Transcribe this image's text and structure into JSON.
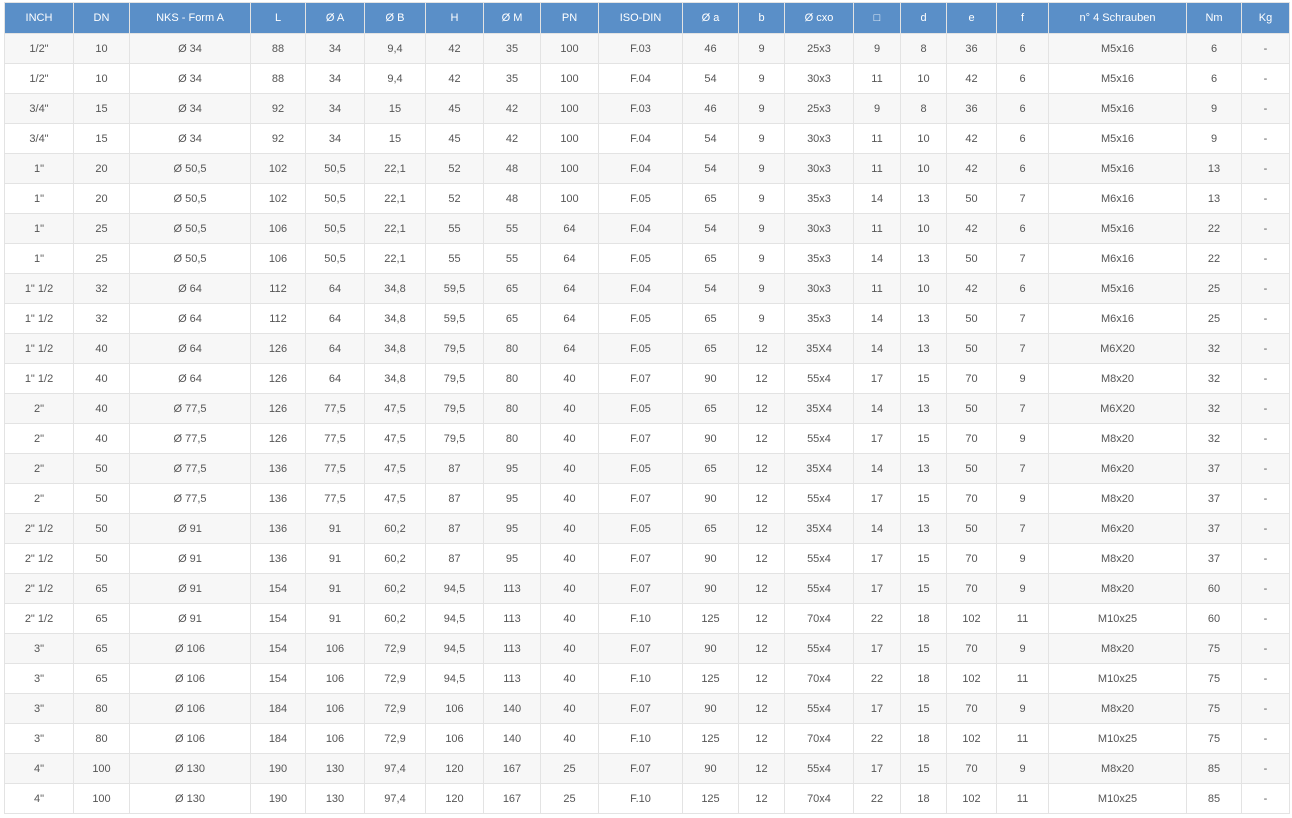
{
  "table": {
    "headers": [
      "INCH",
      "DN",
      "NKS - Form A",
      "L",
      "Ø A",
      "Ø B",
      "H",
      "Ø M",
      "PN",
      "ISO-DIN",
      "Ø a",
      "b",
      "Ø cxo",
      "□",
      "d",
      "e",
      "f",
      "n° 4 Schrauben",
      "Nm",
      "Kg"
    ],
    "rows": [
      [
        "1/2\"",
        "10",
        "Ø 34",
        "88",
        "34",
        "9,4",
        "42",
        "35",
        "100",
        "F.03",
        "46",
        "9",
        "25x3",
        "9",
        "8",
        "36",
        "6",
        "M5x16",
        "6",
        "-"
      ],
      [
        "1/2\"",
        "10",
        "Ø 34",
        "88",
        "34",
        "9,4",
        "42",
        "35",
        "100",
        "F.04",
        "54",
        "9",
        "30x3",
        "11",
        "10",
        "42",
        "6",
        "M5x16",
        "6",
        "-"
      ],
      [
        "3/4\"",
        "15",
        "Ø 34",
        "92",
        "34",
        "15",
        "45",
        "42",
        "100",
        "F.03",
        "46",
        "9",
        "25x3",
        "9",
        "8",
        "36",
        "6",
        "M5x16",
        "9",
        "-"
      ],
      [
        "3/4\"",
        "15",
        "Ø 34",
        "92",
        "34",
        "15",
        "45",
        "42",
        "100",
        "F.04",
        "54",
        "9",
        "30x3",
        "11",
        "10",
        "42",
        "6",
        "M5x16",
        "9",
        "-"
      ],
      [
        "1\"",
        "20",
        "Ø 50,5",
        "102",
        "50,5",
        "22,1",
        "52",
        "48",
        "100",
        "F.04",
        "54",
        "9",
        "30x3",
        "11",
        "10",
        "42",
        "6",
        "M5x16",
        "13",
        "-"
      ],
      [
        "1\"",
        "20",
        "Ø 50,5",
        "102",
        "50,5",
        "22,1",
        "52",
        "48",
        "100",
        "F.05",
        "65",
        "9",
        "35x3",
        "14",
        "13",
        "50",
        "7",
        "M6x16",
        "13",
        "-"
      ],
      [
        "1\"",
        "25",
        "Ø 50,5",
        "106",
        "50,5",
        "22,1",
        "55",
        "55",
        "64",
        "F.04",
        "54",
        "9",
        "30x3",
        "11",
        "10",
        "42",
        "6",
        "M5x16",
        "22",
        "-"
      ],
      [
        "1\"",
        "25",
        "Ø 50,5",
        "106",
        "50,5",
        "22,1",
        "55",
        "55",
        "64",
        "F.05",
        "65",
        "9",
        "35x3",
        "14",
        "13",
        "50",
        "7",
        "M6x16",
        "22",
        "-"
      ],
      [
        "1\" 1/2",
        "32",
        "Ø 64",
        "112",
        "64",
        "34,8",
        "59,5",
        "65",
        "64",
        "F.04",
        "54",
        "9",
        "30x3",
        "11",
        "10",
        "42",
        "6",
        "M5x16",
        "25",
        "-"
      ],
      [
        "1\" 1/2",
        "32",
        "Ø 64",
        "112",
        "64",
        "34,8",
        "59,5",
        "65",
        "64",
        "F.05",
        "65",
        "9",
        "35x3",
        "14",
        "13",
        "50",
        "7",
        "M6x16",
        "25",
        "-"
      ],
      [
        "1\" 1/2",
        "40",
        "Ø 64",
        "126",
        "64",
        "34,8",
        "79,5",
        "80",
        "64",
        "F.05",
        "65",
        "12",
        "35X4",
        "14",
        "13",
        "50",
        "7",
        "M6X20",
        "32",
        "-"
      ],
      [
        "1\" 1/2",
        "40",
        "Ø 64",
        "126",
        "64",
        "34,8",
        "79,5",
        "80",
        "40",
        "F.07",
        "90",
        "12",
        "55x4",
        "17",
        "15",
        "70",
        "9",
        "M8x20",
        "32",
        "-"
      ],
      [
        "2\"",
        "40",
        "Ø 77,5",
        "126",
        "77,5",
        "47,5",
        "79,5",
        "80",
        "40",
        "F.05",
        "65",
        "12",
        "35X4",
        "14",
        "13",
        "50",
        "7",
        "M6X20",
        "32",
        "-"
      ],
      [
        "2\"",
        "40",
        "Ø 77,5",
        "126",
        "77,5",
        "47,5",
        "79,5",
        "80",
        "40",
        "F.07",
        "90",
        "12",
        "55x4",
        "17",
        "15",
        "70",
        "9",
        "M8x20",
        "32",
        "-"
      ],
      [
        "2\"",
        "50",
        "Ø 77,5",
        "136",
        "77,5",
        "47,5",
        "87",
        "95",
        "40",
        "F.05",
        "65",
        "12",
        "35X4",
        "14",
        "13",
        "50",
        "7",
        "M6x20",
        "37",
        "-"
      ],
      [
        "2\"",
        "50",
        "Ø 77,5",
        "136",
        "77,5",
        "47,5",
        "87",
        "95",
        "40",
        "F.07",
        "90",
        "12",
        "55x4",
        "17",
        "15",
        "70",
        "9",
        "M8x20",
        "37",
        "-"
      ],
      [
        "2\" 1/2",
        "50",
        "Ø 91",
        "136",
        "91",
        "60,2",
        "87",
        "95",
        "40",
        "F.05",
        "65",
        "12",
        "35X4",
        "14",
        "13",
        "50",
        "7",
        "M6x20",
        "37",
        "-"
      ],
      [
        "2\" 1/2",
        "50",
        "Ø 91",
        "136",
        "91",
        "60,2",
        "87",
        "95",
        "40",
        "F.07",
        "90",
        "12",
        "55x4",
        "17",
        "15",
        "70",
        "9",
        "M8x20",
        "37",
        "-"
      ],
      [
        "2\" 1/2",
        "65",
        "Ø 91",
        "154",
        "91",
        "60,2",
        "94,5",
        "113",
        "40",
        "F.07",
        "90",
        "12",
        "55x4",
        "17",
        "15",
        "70",
        "9",
        "M8x20",
        "60",
        "-"
      ],
      [
        "2\" 1/2",
        "65",
        "Ø 91",
        "154",
        "91",
        "60,2",
        "94,5",
        "113",
        "40",
        "F.10",
        "125",
        "12",
        "70x4",
        "22",
        "18",
        "102",
        "11",
        "M10x25",
        "60",
        "-"
      ],
      [
        "3\"",
        "65",
        "Ø 106",
        "154",
        "106",
        "72,9",
        "94,5",
        "113",
        "40",
        "F.07",
        "90",
        "12",
        "55x4",
        "17",
        "15",
        "70",
        "9",
        "M8x20",
        "75",
        "-"
      ],
      [
        "3\"",
        "65",
        "Ø 106",
        "154",
        "106",
        "72,9",
        "94,5",
        "113",
        "40",
        "F.10",
        "125",
        "12",
        "70x4",
        "22",
        "18",
        "102",
        "11",
        "M10x25",
        "75",
        "-"
      ],
      [
        "3\"",
        "80",
        "Ø 106",
        "184",
        "106",
        "72,9",
        "106",
        "140",
        "40",
        "F.07",
        "90",
        "12",
        "55x4",
        "17",
        "15",
        "70",
        "9",
        "M8x20",
        "75",
        "-"
      ],
      [
        "3\"",
        "80",
        "Ø 106",
        "184",
        "106",
        "72,9",
        "106",
        "140",
        "40",
        "F.10",
        "125",
        "12",
        "70x4",
        "22",
        "18",
        "102",
        "11",
        "M10x25",
        "75",
        "-"
      ],
      [
        "4\"",
        "100",
        "Ø 130",
        "190",
        "130",
        "97,4",
        "120",
        "167",
        "25",
        "F.07",
        "90",
        "12",
        "55x4",
        "17",
        "15",
        "70",
        "9",
        "M8x20",
        "85",
        "-"
      ],
      [
        "4\"",
        "100",
        "Ø 130",
        "190",
        "130",
        "97,4",
        "120",
        "167",
        "25",
        "F.10",
        "125",
        "12",
        "70x4",
        "22",
        "18",
        "102",
        "11",
        "M10x25",
        "85",
        "-"
      ]
    ]
  },
  "colors": {
    "header_bg": "#5a8fc8",
    "header_text": "#ffffff",
    "row_stripe": "#f7f7f7",
    "row_plain": "#ffffff",
    "border": "#e3e3e3",
    "cell_text": "#555555"
  }
}
